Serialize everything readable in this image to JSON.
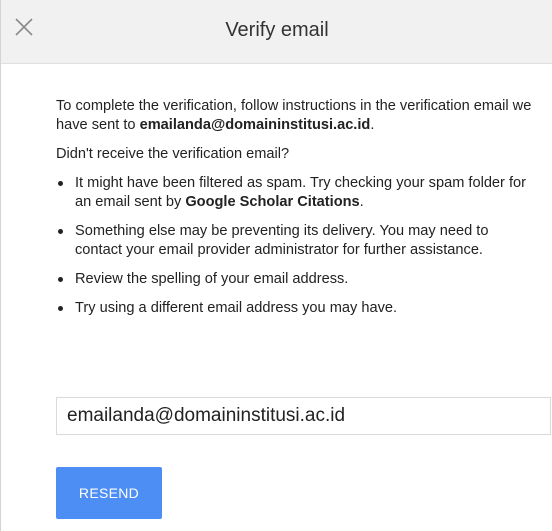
{
  "dialog": {
    "title": "Verify email",
    "close_icon": "close-icon"
  },
  "body": {
    "intro_prefix": "To complete the verification, follow instructions in the verification email we have sent to ",
    "intro_email": "emailanda@domaininstitusi.ac.id",
    "intro_suffix": ".",
    "question": "Didn't receive the verification email?",
    "bullets": [
      {
        "prefix": "It might have been filtered as spam. Try checking your spam folder for an email sent by ",
        "bold": "Google Scholar Citations",
        "suffix": "."
      },
      {
        "text": "Something else may be preventing its delivery. You may need to contact your email provider administrator for further assistance."
      },
      {
        "text": "Review the spelling of your email address."
      },
      {
        "text": "Try using a different email address you may have."
      }
    ]
  },
  "email_field": {
    "value": "emailanda@domaininstitusi.ac.id"
  },
  "actions": {
    "resend_label": "RESEND"
  },
  "colors": {
    "header_bg": "#f1f1f1",
    "button_bg": "#4d8ef5"
  }
}
